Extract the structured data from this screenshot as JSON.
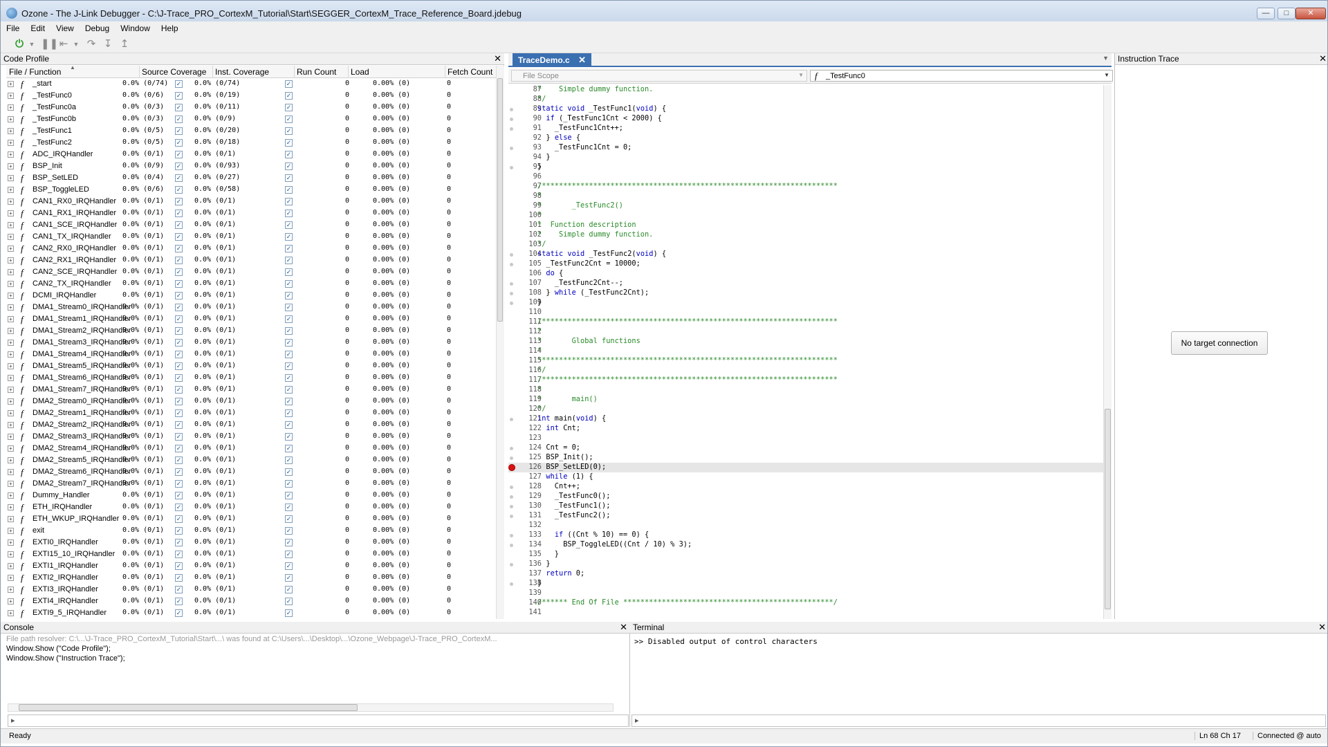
{
  "window": {
    "title": "Ozone - The J-Link Debugger - C:\\J-Trace_PRO_CortexM_Tutorial\\Start\\SEGGER_CortexM_Trace_Reference_Board.jdebug",
    "controls": [
      "minimize-icon",
      "maximize-icon",
      "close-icon"
    ]
  },
  "menu": [
    "File",
    "Edit",
    "View",
    "Debug",
    "Window",
    "Help"
  ],
  "toolbar": {
    "icons": [
      "power-icon",
      "pause-icon",
      "step-back-icon",
      "step-over-icon",
      "step-into-icon",
      "step-out-icon"
    ]
  },
  "code_profile": {
    "title": "Code Profile",
    "columns": [
      "File / Function",
      "Source Coverage",
      "Inst. Coverage",
      "Run Count",
      "Load",
      "Fetch Count"
    ],
    "rows": [
      [
        "_start",
        "0.0% (0/74)",
        "0.0% (0/74)",
        "0",
        "0.00% (0)",
        "0"
      ],
      [
        "_TestFunc0",
        "0.0% (0/6)",
        "0.0% (0/19)",
        "0",
        "0.00% (0)",
        "0"
      ],
      [
        "_TestFunc0a",
        "0.0% (0/3)",
        "0.0% (0/11)",
        "0",
        "0.00% (0)",
        "0"
      ],
      [
        "_TestFunc0b",
        "0.0% (0/3)",
        "0.0% (0/9)",
        "0",
        "0.00% (0)",
        "0"
      ],
      [
        "_TestFunc1",
        "0.0% (0/5)",
        "0.0% (0/20)",
        "0",
        "0.00% (0)",
        "0"
      ],
      [
        "_TestFunc2",
        "0.0% (0/5)",
        "0.0% (0/18)",
        "0",
        "0.00% (0)",
        "0"
      ],
      [
        "ADC_IRQHandler",
        "0.0% (0/1)",
        "0.0% (0/1)",
        "0",
        "0.00% (0)",
        "0"
      ],
      [
        "BSP_Init",
        "0.0% (0/9)",
        "0.0% (0/93)",
        "0",
        "0.00% (0)",
        "0"
      ],
      [
        "BSP_SetLED",
        "0.0% (0/4)",
        "0.0% (0/27)",
        "0",
        "0.00% (0)",
        "0"
      ],
      [
        "BSP_ToggleLED",
        "0.0% (0/6)",
        "0.0% (0/58)",
        "0",
        "0.00% (0)",
        "0"
      ],
      [
        "CAN1_RX0_IRQHandler",
        "0.0% (0/1)",
        "0.0% (0/1)",
        "0",
        "0.00% (0)",
        "0"
      ],
      [
        "CAN1_RX1_IRQHandler",
        "0.0% (0/1)",
        "0.0% (0/1)",
        "0",
        "0.00% (0)",
        "0"
      ],
      [
        "CAN1_SCE_IRQHandler",
        "0.0% (0/1)",
        "0.0% (0/1)",
        "0",
        "0.00% (0)",
        "0"
      ],
      [
        "CAN1_TX_IRQHandler",
        "0.0% (0/1)",
        "0.0% (0/1)",
        "0",
        "0.00% (0)",
        "0"
      ],
      [
        "CAN2_RX0_IRQHandler",
        "0.0% (0/1)",
        "0.0% (0/1)",
        "0",
        "0.00% (0)",
        "0"
      ],
      [
        "CAN2_RX1_IRQHandler",
        "0.0% (0/1)",
        "0.0% (0/1)",
        "0",
        "0.00% (0)",
        "0"
      ],
      [
        "CAN2_SCE_IRQHandler",
        "0.0% (0/1)",
        "0.0% (0/1)",
        "0",
        "0.00% (0)",
        "0"
      ],
      [
        "CAN2_TX_IRQHandler",
        "0.0% (0/1)",
        "0.0% (0/1)",
        "0",
        "0.00% (0)",
        "0"
      ],
      [
        "DCMI_IRQHandler",
        "0.0% (0/1)",
        "0.0% (0/1)",
        "0",
        "0.00% (0)",
        "0"
      ],
      [
        "DMA1_Stream0_IRQHandler",
        "0.0% (0/1)",
        "0.0% (0/1)",
        "0",
        "0.00% (0)",
        "0"
      ],
      [
        "DMA1_Stream1_IRQHandler",
        "0.0% (0/1)",
        "0.0% (0/1)",
        "0",
        "0.00% (0)",
        "0"
      ],
      [
        "DMA1_Stream2_IRQHandler",
        "0.0% (0/1)",
        "0.0% (0/1)",
        "0",
        "0.00% (0)",
        "0"
      ],
      [
        "DMA1_Stream3_IRQHandler",
        "0.0% (0/1)",
        "0.0% (0/1)",
        "0",
        "0.00% (0)",
        "0"
      ],
      [
        "DMA1_Stream4_IRQHandler",
        "0.0% (0/1)",
        "0.0% (0/1)",
        "0",
        "0.00% (0)",
        "0"
      ],
      [
        "DMA1_Stream5_IRQHandler",
        "0.0% (0/1)",
        "0.0% (0/1)",
        "0",
        "0.00% (0)",
        "0"
      ],
      [
        "DMA1_Stream6_IRQHandler",
        "0.0% (0/1)",
        "0.0% (0/1)",
        "0",
        "0.00% (0)",
        "0"
      ],
      [
        "DMA1_Stream7_IRQHandler",
        "0.0% (0/1)",
        "0.0% (0/1)",
        "0",
        "0.00% (0)",
        "0"
      ],
      [
        "DMA2_Stream0_IRQHandler",
        "0.0% (0/1)",
        "0.0% (0/1)",
        "0",
        "0.00% (0)",
        "0"
      ],
      [
        "DMA2_Stream1_IRQHandler",
        "0.0% (0/1)",
        "0.0% (0/1)",
        "0",
        "0.00% (0)",
        "0"
      ],
      [
        "DMA2_Stream2_IRQHandler",
        "0.0% (0/1)",
        "0.0% (0/1)",
        "0",
        "0.00% (0)",
        "0"
      ],
      [
        "DMA2_Stream3_IRQHandler",
        "0.0% (0/1)",
        "0.0% (0/1)",
        "0",
        "0.00% (0)",
        "0"
      ],
      [
        "DMA2_Stream4_IRQHandler",
        "0.0% (0/1)",
        "0.0% (0/1)",
        "0",
        "0.00% (0)",
        "0"
      ],
      [
        "DMA2_Stream5_IRQHandler",
        "0.0% (0/1)",
        "0.0% (0/1)",
        "0",
        "0.00% (0)",
        "0"
      ],
      [
        "DMA2_Stream6_IRQHandler",
        "0.0% (0/1)",
        "0.0% (0/1)",
        "0",
        "0.00% (0)",
        "0"
      ],
      [
        "DMA2_Stream7_IRQHandler",
        "0.0% (0/1)",
        "0.0% (0/1)",
        "0",
        "0.00% (0)",
        "0"
      ],
      [
        "Dummy_Handler",
        "0.0% (0/1)",
        "0.0% (0/1)",
        "0",
        "0.00% (0)",
        "0"
      ],
      [
        "ETH_IRQHandler",
        "0.0% (0/1)",
        "0.0% (0/1)",
        "0",
        "0.00% (0)",
        "0"
      ],
      [
        "ETH_WKUP_IRQHandler",
        "0.0% (0/1)",
        "0.0% (0/1)",
        "0",
        "0.00% (0)",
        "0"
      ],
      [
        "exit",
        "0.0% (0/1)",
        "0.0% (0/1)",
        "0",
        "0.00% (0)",
        "0"
      ],
      [
        "EXTI0_IRQHandler",
        "0.0% (0/1)",
        "0.0% (0/1)",
        "0",
        "0.00% (0)",
        "0"
      ],
      [
        "EXTI15_10_IRQHandler",
        "0.0% (0/1)",
        "0.0% (0/1)",
        "0",
        "0.00% (0)",
        "0"
      ],
      [
        "EXTI1_IRQHandler",
        "0.0% (0/1)",
        "0.0% (0/1)",
        "0",
        "0.00% (0)",
        "0"
      ],
      [
        "EXTI2_IRQHandler",
        "0.0% (0/1)",
        "0.0% (0/1)",
        "0",
        "0.00% (0)",
        "0"
      ],
      [
        "EXTI3_IRQHandler",
        "0.0% (0/1)",
        "0.0% (0/1)",
        "0",
        "0.00% (0)",
        "0"
      ],
      [
        "EXTI4_IRQHandler",
        "0.0% (0/1)",
        "0.0% (0/1)",
        "0",
        "0.00% (0)",
        "0"
      ],
      [
        "EXTI9_5_IRQHandler",
        "0.0% (0/1)",
        "0.0% (0/1)",
        "0",
        "0.00% (0)",
        "0"
      ]
    ]
  },
  "editor": {
    "tab": "TraceDemo.c",
    "scope_placeholder": "File Scope",
    "function_selected": "_TestFunc0",
    "current_line": 126,
    "breakpoint_line": 126,
    "lines": [
      {
        "n": 87,
        "t": "*    Simple dummy function.",
        "c": true
      },
      {
        "n": 88,
        "t": "*/",
        "c": true
      },
      {
        "n": 89,
        "t": "static void _TestFunc1(void) {",
        "d": true
      },
      {
        "n": 90,
        "t": "  if (_TestFunc1Cnt < 2000) {",
        "d": true
      },
      {
        "n": 91,
        "t": "    _TestFunc1Cnt++;",
        "d": true
      },
      {
        "n": 92,
        "t": "  } else {"
      },
      {
        "n": 93,
        "t": "    _TestFunc1Cnt = 0;",
        "d": true
      },
      {
        "n": 94,
        "t": "  }"
      },
      {
        "n": 95,
        "t": "}",
        "d": true
      },
      {
        "n": 96,
        "t": ""
      },
      {
        "n": 97,
        "t": "/*********************************************************************",
        "c": true
      },
      {
        "n": 98,
        "t": "*",
        "c": true
      },
      {
        "n": 99,
        "t": "*       _TestFunc2()",
        "c": true
      },
      {
        "n": 100,
        "t": "*",
        "c": true
      },
      {
        "n": 101,
        "t": "*  Function description",
        "c": true
      },
      {
        "n": 102,
        "t": "*    Simple dummy function.",
        "c": true
      },
      {
        "n": 103,
        "t": "*/",
        "c": true
      },
      {
        "n": 104,
        "t": "static void _TestFunc2(void) {",
        "d": true
      },
      {
        "n": 105,
        "t": "  _TestFunc2Cnt = 10000;",
        "d": true
      },
      {
        "n": 106,
        "t": "  do {"
      },
      {
        "n": 107,
        "t": "    _TestFunc2Cnt--;",
        "d": true
      },
      {
        "n": 108,
        "t": "  } while (_TestFunc2Cnt);",
        "d": true
      },
      {
        "n": 109,
        "t": "}",
        "d": true
      },
      {
        "n": 110,
        "t": ""
      },
      {
        "n": 111,
        "t": "/*********************************************************************",
        "c": true
      },
      {
        "n": 112,
        "t": "*",
        "c": true
      },
      {
        "n": 113,
        "t": "*       Global functions",
        "c": true
      },
      {
        "n": 114,
        "t": "*",
        "c": true
      },
      {
        "n": 115,
        "t": "**********************************************************************",
        "c": true
      },
      {
        "n": 116,
        "t": "*/",
        "c": true
      },
      {
        "n": 117,
        "t": "/*********************************************************************",
        "c": true
      },
      {
        "n": 118,
        "t": "*",
        "c": true
      },
      {
        "n": 119,
        "t": "*       main()",
        "c": true
      },
      {
        "n": 120,
        "t": "*/",
        "c": true
      },
      {
        "n": 121,
        "t": "int main(void) {",
        "d": true
      },
      {
        "n": 122,
        "t": "  int Cnt;"
      },
      {
        "n": 123,
        "t": ""
      },
      {
        "n": 124,
        "t": "  Cnt = 0;",
        "d": true
      },
      {
        "n": 125,
        "t": "  BSP_Init();",
        "d": true
      },
      {
        "n": 126,
        "t": "  BSP_SetLED(0);"
      },
      {
        "n": 127,
        "t": "  while (1) {"
      },
      {
        "n": 128,
        "t": "    Cnt++;",
        "d": true
      },
      {
        "n": 129,
        "t": "    _TestFunc0();",
        "d": true
      },
      {
        "n": 130,
        "t": "    _TestFunc1();",
        "d": true
      },
      {
        "n": 131,
        "t": "    _TestFunc2();",
        "d": true
      },
      {
        "n": 132,
        "t": ""
      },
      {
        "n": 133,
        "t": "    if ((Cnt % 10) == 0) {",
        "d": true
      },
      {
        "n": 134,
        "t": "      BSP_ToggleLED((Cnt / 10) % 3);",
        "d": true
      },
      {
        "n": 135,
        "t": "    }"
      },
      {
        "n": 136,
        "t": "  }",
        "d": true
      },
      {
        "n": 137,
        "t": "  return 0;"
      },
      {
        "n": 138,
        "t": "}",
        "d": true
      },
      {
        "n": 139,
        "t": ""
      },
      {
        "n": 140,
        "t": "/****** End Of File *************************************************/",
        "c": true
      },
      {
        "n": 141,
        "t": ""
      }
    ]
  },
  "instruction_trace": {
    "title": "Instruction Trace",
    "message": "No target connection"
  },
  "console": {
    "title": "Console",
    "lines": [
      "File path resolver: C:\\...\\J-Trace_PRO_CortexM_Tutorial\\Start\\...\\ was found at C:\\Users\\...\\Desktop\\...\\Ozone_Webpage\\J-Trace_PRO_CortexM...",
      "Window.Show (\"Code Profile\");",
      "Window.Show (\"Instruction Trace\");"
    ],
    "input": ""
  },
  "terminal": {
    "title": "Terminal",
    "lines": [
      ">> Disabled output of control characters"
    ],
    "input": ""
  },
  "status": {
    "left": "Ready",
    "position": "Ln 68  Ch 17",
    "connection": "Connected @ auto"
  }
}
